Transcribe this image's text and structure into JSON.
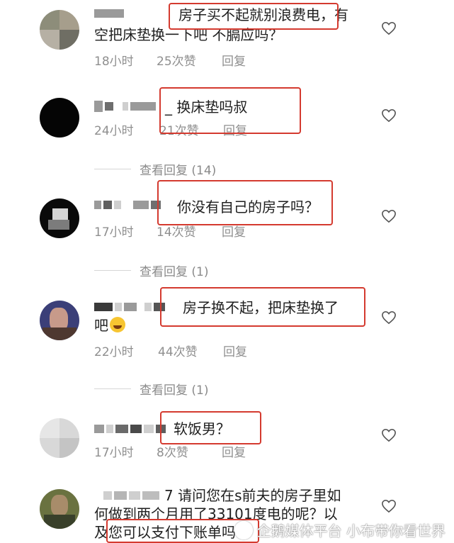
{
  "comments": [
    {
      "line1": "房子买不起就别浪费电，有",
      "line2": "空把床垫换一下吧  不膈应吗？",
      "time": "18小时",
      "likes": "25次赞",
      "reply": "回复"
    },
    {
      "line1": "_ 换床垫吗叔",
      "time": "24小时",
      "likes": "21次赞",
      "reply": "回复",
      "view_replies": "查看回复 (14)"
    },
    {
      "line1": "你没有自己的房子吗？",
      "time": "17小时",
      "likes": "14次赞",
      "reply": "回复",
      "view_replies": "查看回复 (1)"
    },
    {
      "line1": "房子换不起，把床垫换了",
      "line2": "吧",
      "time": "22小时",
      "likes": "44次赞",
      "reply": "回复",
      "view_replies": "查看回复 (1)"
    },
    {
      "line1": "软饭男？",
      "time": "17小时",
      "likes": "8次赞",
      "reply": "回复"
    },
    {
      "line1_prefix": "7",
      "line1": "请问您在s前夫的房子里如",
      "line2": "何做到两个月用了33101度电的呢？以",
      "line3": "及您可以支付下账单吗"
    }
  ],
  "watermark": "企鹅媒体平台 小布带你看世界",
  "icons": {
    "like": "heart-outline-icon",
    "emoji": "laughing-emoji-icon"
  },
  "colors": {
    "highlight": "#d43a2f",
    "meta": "#8f8f8f"
  }
}
